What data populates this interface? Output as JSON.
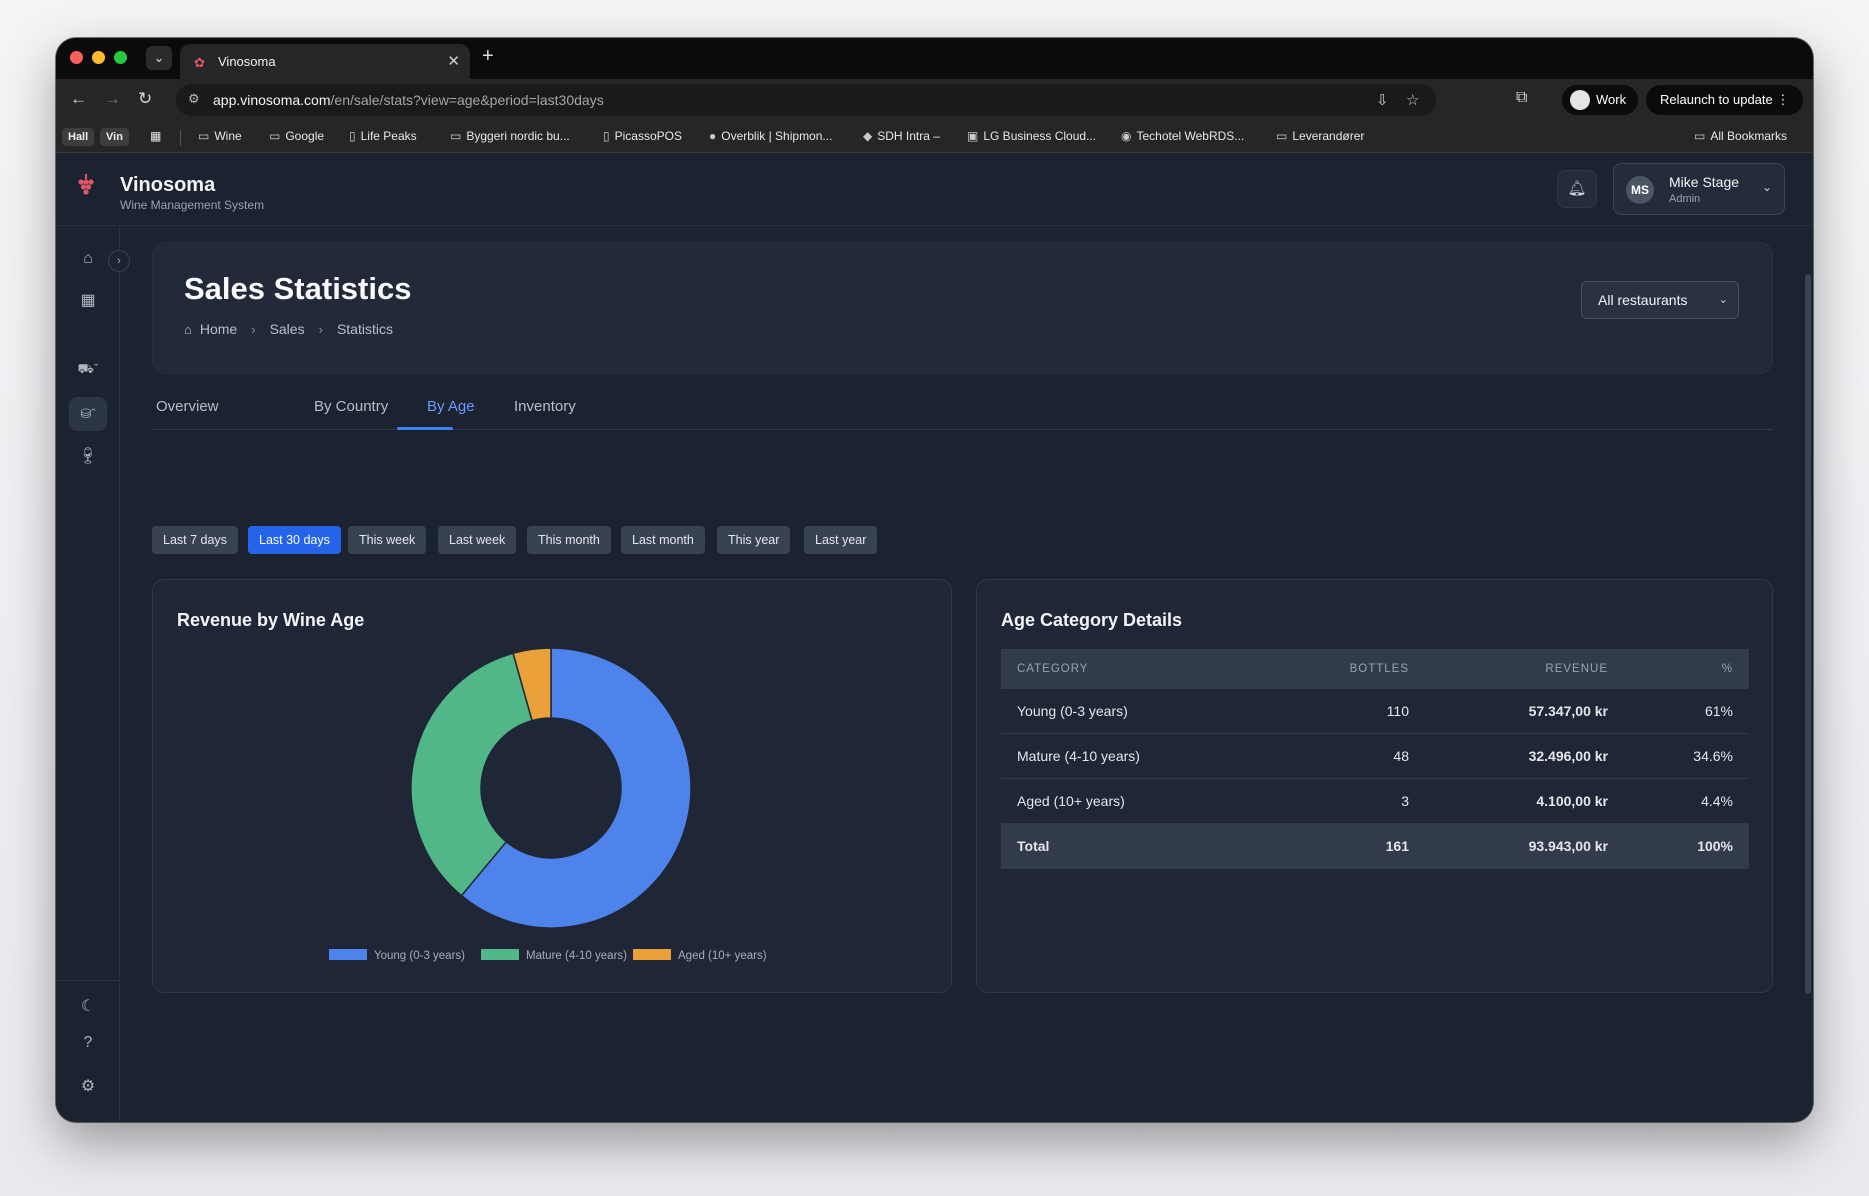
{
  "browser": {
    "tab_title": "Vinosoma",
    "url_domain": "app.vinosoma.com",
    "url_path": "/en/sale/stats?view=age&period=last30days",
    "profile_label": "Work",
    "relaunch_label": "Relaunch to update",
    "bookmarks_chips": [
      "Hall",
      "Vin"
    ],
    "bookmarks": [
      "Wine",
      "Google",
      "Life Peaks",
      "Byggeri nordic bu...",
      "PicassoPOS",
      "Overblik | Shipmon...",
      "SDH Intra –",
      "LG Business Cloud...",
      "Techotel WebRDS...",
      "Leverandører"
    ],
    "all_bookmarks": "All Bookmarks"
  },
  "app": {
    "brand": "Vinosoma",
    "brand_sub": "Wine Management System",
    "user": {
      "initials": "MS",
      "name": "Mike Stage",
      "role": "Admin"
    }
  },
  "page": {
    "title": "Sales Statistics",
    "breadcrumb": [
      "Home",
      "Sales",
      "Statistics"
    ],
    "restaurant_select": "All restaurants",
    "tabs": [
      "Overview",
      "By Country",
      "By Age",
      "Inventory"
    ],
    "active_tab": "By Age",
    "periods": [
      "Last 7 days",
      "Last 30 days",
      "This week",
      "Last week",
      "This month",
      "Last month",
      "This year",
      "Last year"
    ],
    "active_period": "Last 30 days"
  },
  "chart_card": {
    "title": "Revenue by Wine Age"
  },
  "chart_data": {
    "type": "pie",
    "donut": true,
    "categories": [
      "Young (0-3 years)",
      "Mature (4-10 years)",
      "Aged (10+ years)"
    ],
    "values": [
      57347,
      32496,
      4100
    ],
    "colors": [
      "#4f83ec",
      "#52b788",
      "#eba13a"
    ],
    "legend": "bottom"
  },
  "table_card": {
    "title": "Age Category Details",
    "headers": [
      "CATEGORY",
      "BOTTLES",
      "REVENUE",
      "%"
    ],
    "rows": [
      [
        "Young (0-3 years)",
        "110",
        "57.347,00 kr",
        "61%"
      ],
      [
        "Mature (4-10 years)",
        "48",
        "32.496,00 kr",
        "34.6%"
      ],
      [
        "Aged (10+ years)",
        "3",
        "4.100,00 kr",
        "4.4%"
      ]
    ],
    "total": [
      "Total",
      "161",
      "93.943,00 kr",
      "100%"
    ]
  }
}
